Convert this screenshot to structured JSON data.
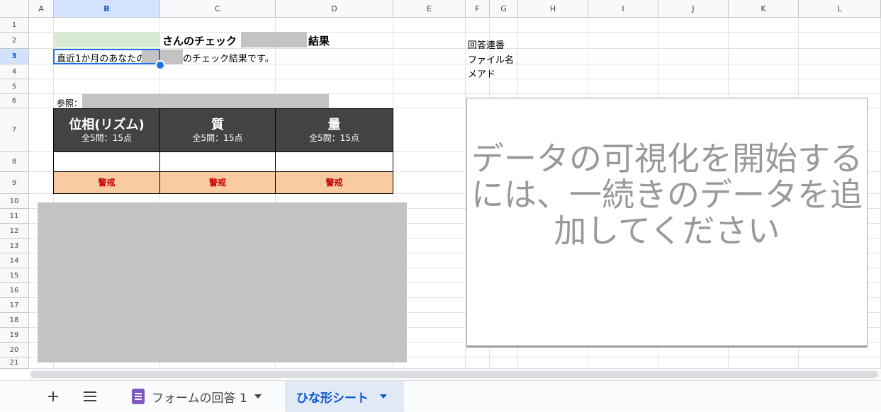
{
  "columns": [
    "A",
    "B",
    "C",
    "D",
    "E",
    "F",
    "G",
    "H",
    "I",
    "J",
    "K",
    "L"
  ],
  "rows": [
    "1",
    "2",
    "3",
    "4",
    "5",
    "6",
    "7",
    "8",
    "9",
    "10",
    "11",
    "12",
    "13",
    "14",
    "15",
    "16",
    "17",
    "18",
    "19",
    "20",
    "21"
  ],
  "sheet": {
    "title_suffix_1": "さんのチェック",
    "title_suffix_2": "結果",
    "row3_text_1": "直近1か月のあなたの",
    "row3_text_2": "のチェック結果です。",
    "reference_label": "参照：",
    "side_labels": [
      "回答連番",
      "ファイル名",
      "メアド"
    ],
    "table_headers": [
      {
        "title": "位相(リズム)",
        "sub": "全5問：15点"
      },
      {
        "title": "質",
        "sub": "全5問：15点"
      },
      {
        "title": "量",
        "sub": "全5問：15点"
      }
    ],
    "status_values": [
      "警戒",
      "警戒",
      "警戒"
    ]
  },
  "chart": {
    "placeholder": "データの可視化を開始するには、一続きのデータを追加してください"
  },
  "tabs": {
    "add_icon": "plus-icon",
    "menu_icon": "menu-icon",
    "items": [
      {
        "label": "フォームの回答 1",
        "active": false
      },
      {
        "label": "ひな形シート",
        "active": true
      }
    ]
  },
  "colors": {
    "header_dark": "#434343",
    "status_fill": "#f8cba3",
    "status_text": "#cc0000",
    "selection": "#1a73e8",
    "b2_fill": "#d9ead3"
  }
}
